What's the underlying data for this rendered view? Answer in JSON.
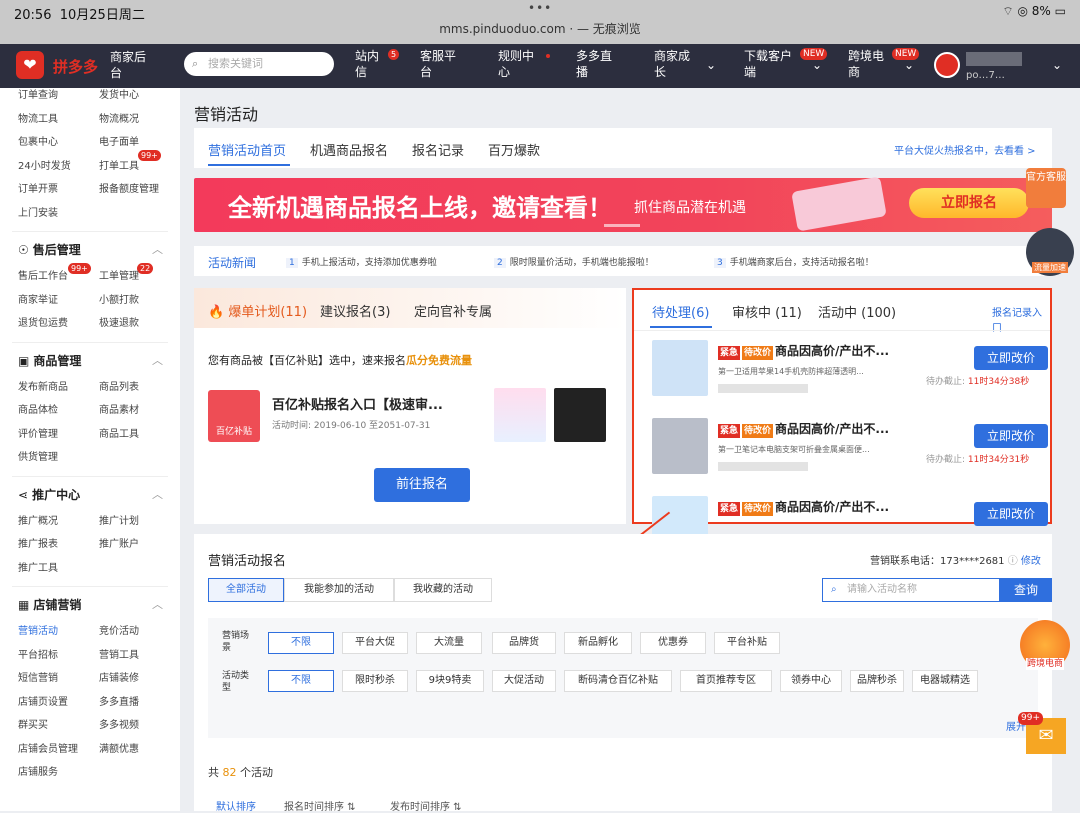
{
  "status": {
    "time": "20:56",
    "date": "10月25日周二",
    "url": "mms.pinduoduo.com ⋅ — 无痕浏览",
    "battery": "8%"
  },
  "nav": {
    "logo_text": "拼多多",
    "biz": "商家后台",
    "search_placeholder": "搜索关键词",
    "items": [
      "站内信",
      "客服平台",
      "规则中心",
      "多多直播",
      "商家成长",
      "下载客户端",
      "跨境电商"
    ],
    "msg_badge": "5",
    "new_badge": "NEW",
    "user": "po…7…"
  },
  "sidebar": {
    "top": [
      [
        "订单查询",
        "发货中心"
      ],
      [
        "物流工具",
        "物流概况"
      ],
      [
        "包裹中心",
        "电子面单"
      ],
      [
        "24小时发货",
        "打单工具"
      ],
      [
        "订单开票",
        "报备额度管理"
      ],
      [
        "上门安装",
        ""
      ]
    ],
    "top_badge": "99+",
    "after_sales": {
      "title": "售后管理",
      "items": [
        [
          "售后工作台",
          "工单管理"
        ],
        [
          "商家举证",
          "小额打款"
        ],
        [
          "退货包运费",
          "极速退款"
        ]
      ],
      "b1": "99+",
      "b2": "22"
    },
    "goods": {
      "title": "商品管理",
      "items": [
        [
          "发布新商品",
          "商品列表"
        ],
        [
          "商品体检",
          "商品素材"
        ],
        [
          "评价管理",
          "商品工具"
        ],
        [
          "供货管理",
          ""
        ]
      ]
    },
    "promo": {
      "title": "推广中心",
      "items": [
        [
          "推广概况",
          "推广计划"
        ],
        [
          "推广报表",
          "推广账户"
        ],
        [
          "推广工具",
          ""
        ]
      ]
    },
    "shop": {
      "title": "店铺营销",
      "items": [
        [
          "营销活动",
          "竞价活动"
        ],
        [
          "平台招标",
          "营销工具"
        ],
        [
          "短信营销",
          "店铺装修"
        ],
        [
          "店铺页设置",
          "多多直播"
        ],
        [
          "群买买",
          "多多视频"
        ],
        [
          "店铺会员管理",
          "满额优惠"
        ],
        [
          "店铺服务",
          ""
        ]
      ]
    }
  },
  "page": {
    "title": "营销活动",
    "tabs": [
      "营销活动首页",
      "机遇商品报名",
      "报名记录",
      "百万爆款"
    ],
    "right_link": "平台大促火热报名中，去看看 >"
  },
  "banner": {
    "headline": "全新机遇商品报名上线，邀请查看！",
    "sub": "抓住商品潜在机遇",
    "btn": "立即报名"
  },
  "news": {
    "label": "活动新闻",
    "items": [
      {
        "n": "1",
        "t": "手机上报活动，支持添加优惠券啦"
      },
      {
        "n": "2",
        "t": "限时限量价活动，手机端也能报啦！"
      },
      {
        "n": "3",
        "t": "手机端商家后台，支持活动报名啦！"
      }
    ]
  },
  "left_panel": {
    "tabs": [
      "爆单计划(11)",
      "建议报名(3)",
      "定向官补专属"
    ],
    "desc": "您有商品被【百亿补贴】选中，速来报名",
    "desc_hl": "瓜分免费流量",
    "icon_text": "百亿补贴",
    "item_title": "百亿补贴报名入口【极速审...",
    "item_time": "活动时间: 2019-06-10 至2051-07-31",
    "btn": "前往报名"
  },
  "right_panel": {
    "tabs": [
      "待处理(6)",
      "审核中 (11)",
      "活动中 (100)"
    ],
    "link": "报名记录入口",
    "items": [
      {
        "tag1": "紧急",
        "tag2": "待改价",
        "title": "商品因高价/产出不...",
        "desc": "第一卫适用苹果14手机壳防摔超薄透明...",
        "deadline_pre": "待办截止: ",
        "deadline": "11时34分38秒",
        "btn": "立即改价"
      },
      {
        "tag1": "紧急",
        "tag2": "待改价",
        "title": "商品因高价/产出不...",
        "desc": "第一卫笔记本电脑支架可折叠金属桌面便...",
        "deadline_pre": "待办截止: ",
        "deadline": "11时34分31秒",
        "btn": "立即改价"
      },
      {
        "tag1": "紧急",
        "tag2": "待改价",
        "title": "商品因高价/产出不...",
        "desc": "",
        "deadline_pre": "",
        "deadline": "",
        "btn": "立即改价"
      }
    ]
  },
  "signup": {
    "title": "营销活动报名",
    "phone": "营销联系电话：173****2681",
    "edit": "修改",
    "tabs": [
      "全部活动",
      "我能参加的活动",
      "我收藏的活动"
    ],
    "search_placeholder": "请输入活动名称",
    "search_btn": "查询",
    "scene_label": "营销场景",
    "scene_chips": [
      "不限",
      "平台大促",
      "大流量",
      "品牌货",
      "新品孵化",
      "优惠券",
      "平台补贴"
    ],
    "type_label": "活动类型",
    "type_chips": [
      "不限",
      "限时秒杀",
      "9块9特卖",
      "大促活动",
      "断码清仓百亿补贴",
      "首页推荐专区",
      "领券中心",
      "品牌秒杀",
      "电器城精选"
    ],
    "expand": "展开",
    "total_pre": "共 ",
    "total": "82",
    "total_post": " 个活动",
    "sort": [
      "默认排序",
      "报名时间排序 ⇅",
      "发布时间排序 ⇅"
    ]
  },
  "float": {
    "service": "官方客服",
    "traffic": "流量加速",
    "cross": "跨境电商",
    "msg_badge": "99+"
  }
}
